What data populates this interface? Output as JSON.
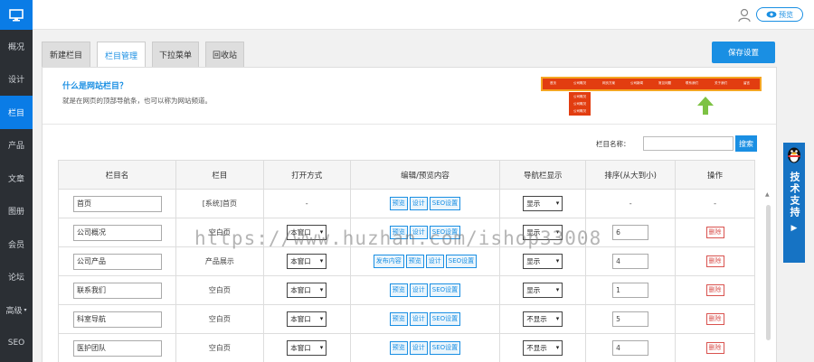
{
  "sidebar": {
    "logo_icon": "monitor-icon",
    "items": [
      {
        "label": "概况",
        "active": false
      },
      {
        "label": "设计",
        "active": false
      },
      {
        "label": "栏目",
        "active": true
      },
      {
        "label": "产品",
        "active": false
      },
      {
        "label": "文章",
        "active": false
      },
      {
        "label": "图册",
        "active": false
      },
      {
        "label": "会员",
        "active": false
      },
      {
        "label": "论坛",
        "active": false
      },
      {
        "label": "高级",
        "active": false,
        "caret": "▾"
      },
      {
        "label": "SEO",
        "active": false
      }
    ]
  },
  "topbar": {
    "preview_label": "预览",
    "user_icon": "user-icon",
    "eye_icon": "eye-icon"
  },
  "tabs": [
    "新建栏目",
    "栏目管理",
    "下拉菜单",
    "回收站"
  ],
  "active_tab": 1,
  "save_button": "保存设置",
  "info": {
    "title": "什么是网站栏目？",
    "description": "就是在网页的顶部导航条，也可以称为网站频道。"
  },
  "demo_nav": {
    "items": [
      "首页",
      "公司概况",
      "网页方案",
      "公司新闻",
      "常见问题",
      "联系我们",
      "关于我们",
      "留言"
    ],
    "dropdown": [
      "公司概况",
      "公司概况",
      "公司概况"
    ]
  },
  "search": {
    "label": "栏目名称：",
    "button": "搜索",
    "value": ""
  },
  "table": {
    "headers": [
      "栏目名",
      "栏目",
      "打开方式",
      "编辑/预览内容",
      "导航栏显示",
      "排序(从大到小)",
      "操作"
    ],
    "rows": [
      {
        "name": "首页",
        "type": "[系统]首页",
        "open": "-",
        "ops": [
          "预览",
          "设计",
          "SEO设置"
        ],
        "show": "显示",
        "sort": "-",
        "action": "-"
      },
      {
        "name": "公司概况",
        "type": "空白页",
        "open": "本窗口",
        "ops": [
          "预览",
          "设计",
          "SEO设置"
        ],
        "show": "显示",
        "sort": "6",
        "action": "删除"
      },
      {
        "name": "公司产品",
        "type": "产品展示",
        "open": "本窗口",
        "ops": [
          "发布内容",
          "预览",
          "设计",
          "SEO设置"
        ],
        "show": "显示",
        "sort": "4",
        "action": "删除"
      },
      {
        "name": "联系我们",
        "type": "空白页",
        "open": "本窗口",
        "ops": [
          "预览",
          "设计",
          "SEO设置"
        ],
        "show": "显示",
        "sort": "1",
        "action": "删除"
      },
      {
        "name": "科室导航",
        "type": "空白页",
        "open": "本窗口",
        "ops": [
          "预览",
          "设计",
          "SEO设置"
        ],
        "show": "不显示",
        "sort": "5",
        "action": "删除"
      },
      {
        "name": "医护团队",
        "type": "空白页",
        "open": "本窗口",
        "ops": [
          "预览",
          "设计",
          "SEO设置"
        ],
        "show": "不显示",
        "sort": "4",
        "action": "删除"
      }
    ]
  },
  "support": {
    "label": "技术支持",
    "icon": "qq-penguin-icon"
  },
  "watermark": "https://www.huzhan.com/ishop33008",
  "colors": {
    "accent": "#1a8fe3",
    "sidebar_bg": "#2b2f34",
    "danger": "#d9534f"
  }
}
